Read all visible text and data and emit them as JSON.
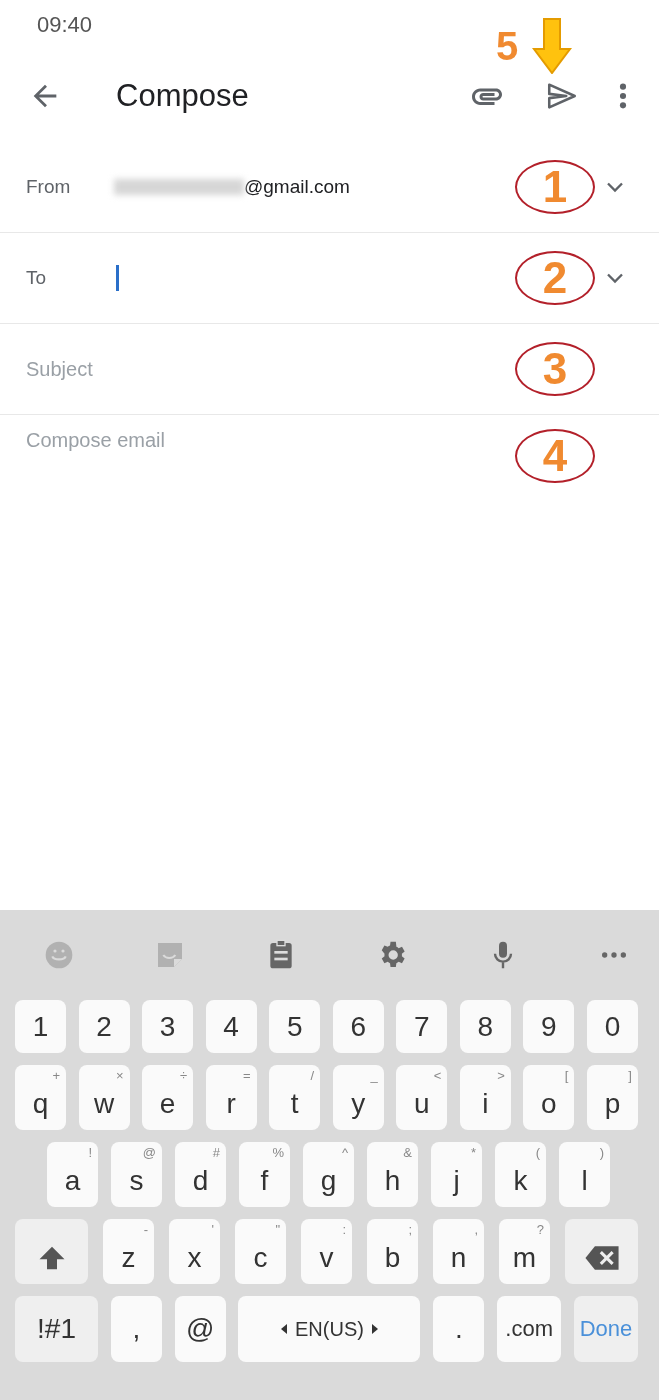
{
  "status_bar": {
    "time": "09:40"
  },
  "app_bar": {
    "title": "Compose",
    "callout": {
      "label": "5"
    }
  },
  "fields": [
    {
      "kind": "account",
      "label": "From",
      "value": "@gmail.com",
      "redacted": true,
      "expandable": true,
      "marker": "1"
    },
    {
      "kind": "recipient",
      "label": "To",
      "focused": true,
      "expandable": true,
      "marker": "2"
    },
    {
      "kind": "line",
      "placeholder": "Subject",
      "marker": "3"
    },
    {
      "kind": "body",
      "placeholder": "Compose email",
      "marker": "4"
    }
  ],
  "keyboard": {
    "toolbar": [
      {
        "kind": "emoji",
        "disabled": true
      },
      {
        "kind": "sticker",
        "disabled": true
      },
      {
        "kind": "clipboard",
        "disabled": false
      },
      {
        "kind": "settings",
        "disabled": false
      },
      {
        "kind": "mic",
        "disabled": false
      },
      {
        "kind": "more",
        "disabled": false
      }
    ],
    "rows": [
      {
        "keys": [
          {
            "kind": "char",
            "label": "1"
          },
          {
            "kind": "char",
            "label": "2"
          },
          {
            "kind": "char",
            "label": "3"
          },
          {
            "kind": "char",
            "label": "4"
          },
          {
            "kind": "char",
            "label": "5"
          },
          {
            "kind": "char",
            "label": "6"
          },
          {
            "kind": "char",
            "label": "7"
          },
          {
            "kind": "char",
            "label": "8"
          },
          {
            "kind": "char",
            "label": "9"
          },
          {
            "kind": "char",
            "label": "0"
          }
        ]
      },
      {
        "keys": [
          {
            "kind": "char",
            "label": "q",
            "hint": "+"
          },
          {
            "kind": "char",
            "label": "w",
            "hint": "×"
          },
          {
            "kind": "char",
            "label": "e",
            "hint": "÷"
          },
          {
            "kind": "char",
            "label": "r",
            "hint": "="
          },
          {
            "kind": "char",
            "label": "t",
            "hint": "/"
          },
          {
            "kind": "char",
            "label": "y",
            "hint": "_"
          },
          {
            "kind": "char",
            "label": "u",
            "hint": "<"
          },
          {
            "kind": "char",
            "label": "i",
            "hint": ">"
          },
          {
            "kind": "char",
            "label": "o",
            "hint": "["
          },
          {
            "kind": "char",
            "label": "p",
            "hint": "]"
          }
        ]
      },
      {
        "keys": [
          {
            "kind": "char",
            "label": "a",
            "hint": "!"
          },
          {
            "kind": "char",
            "label": "s",
            "hint": "@"
          },
          {
            "kind": "char",
            "label": "d",
            "hint": "#"
          },
          {
            "kind": "char",
            "label": "f",
            "hint": "%"
          },
          {
            "kind": "char",
            "label": "g",
            "hint": "^"
          },
          {
            "kind": "char",
            "label": "h",
            "hint": "&"
          },
          {
            "kind": "char",
            "label": "j",
            "hint": "*"
          },
          {
            "kind": "char",
            "label": "k",
            "hint": "("
          },
          {
            "kind": "char",
            "label": "l",
            "hint": ")"
          }
        ]
      },
      {
        "keys": [
          {
            "kind": "shift"
          },
          {
            "kind": "char",
            "label": "z",
            "hint": "-"
          },
          {
            "kind": "char",
            "label": "x",
            "hint": "'"
          },
          {
            "kind": "char",
            "label": "c",
            "hint": "\""
          },
          {
            "kind": "char",
            "label": "v",
            "hint": ":"
          },
          {
            "kind": "char",
            "label": "b",
            "hint": ";"
          },
          {
            "kind": "char",
            "label": "n",
            "hint": ","
          },
          {
            "kind": "char",
            "label": "m",
            "hint": "?"
          },
          {
            "kind": "backspace"
          }
        ]
      },
      {
        "keys": [
          {
            "kind": "symbols",
            "label": "!#1"
          },
          {
            "kind": "char",
            "label": ","
          },
          {
            "kind": "char",
            "label": "@"
          },
          {
            "kind": "space",
            "label": "EN(US)"
          },
          {
            "kind": "char",
            "label": "."
          },
          {
            "kind": "domain",
            "label": ".com"
          },
          {
            "kind": "done",
            "label": "Done"
          }
        ]
      }
    ]
  }
}
